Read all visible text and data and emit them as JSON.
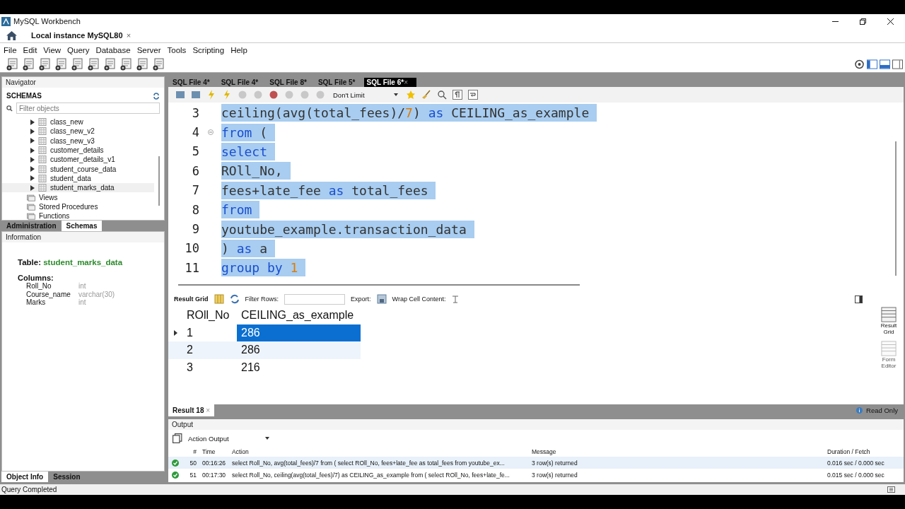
{
  "window": {
    "title": "MySQL Workbench"
  },
  "connection_tab": {
    "label": "Local instance MySQL80",
    "close": "×"
  },
  "menu": [
    "File",
    "Edit",
    "View",
    "Query",
    "Database",
    "Server",
    "Tools",
    "Scripting",
    "Help"
  ],
  "navigator": {
    "title": "Navigator",
    "schemas_label": "SCHEMAS",
    "filter_placeholder": "Filter objects",
    "tables": [
      {
        "name": "class_new",
        "selected": false
      },
      {
        "name": "class_new_v2",
        "selected": false
      },
      {
        "name": "class_new_v3",
        "selected": false
      },
      {
        "name": "customer_details",
        "selected": false
      },
      {
        "name": "customer_details_v1",
        "selected": false
      },
      {
        "name": "student_course_data",
        "selected": false
      },
      {
        "name": "student_data",
        "selected": false
      },
      {
        "name": "student_marks_data",
        "selected": true
      }
    ],
    "folders": [
      "Views",
      "Stored Procedures",
      "Functions"
    ]
  },
  "side_tabs": [
    {
      "label": "Administration",
      "selected": false
    },
    {
      "label": "Schemas",
      "selected": true
    }
  ],
  "information": {
    "title": "Information",
    "table_label": "Table:",
    "table_name": "student_marks_data",
    "columns_label": "Columns:",
    "columns": [
      {
        "name": "Roll_No",
        "type": "int"
      },
      {
        "name": "Course_name",
        "type": "varchar(30)"
      },
      {
        "name": "Marks",
        "type": "int"
      }
    ]
  },
  "bottom_tabs": [
    {
      "label": "Object Info",
      "selected": true
    },
    {
      "label": "Session",
      "selected": false
    }
  ],
  "editor_tabs": [
    {
      "label": "SQL File 4*",
      "selected": false
    },
    {
      "label": "SQL File 4*",
      "selected": false
    },
    {
      "label": "SQL File 8*",
      "selected": false
    },
    {
      "label": "SQL File 5*",
      "selected": false
    },
    {
      "label": "SQL File 6*",
      "selected": true
    }
  ],
  "editor_tab_close": "×",
  "limit": "Don't Limit",
  "code_lines": [
    {
      "number": "3",
      "selected": true,
      "fold": false,
      "tokens": [
        {
          "text": "ceiling(avg(total_fees)/",
          "kind": "plain"
        },
        {
          "text": "7",
          "kind": "number"
        },
        {
          "text": ") ",
          "kind": "plain"
        },
        {
          "text": "as",
          "kind": "keyword"
        },
        {
          "text": " CEILING_as_example",
          "kind": "plain"
        }
      ]
    },
    {
      "number": "4",
      "selected": true,
      "fold": true,
      "tokens": [
        {
          "text": "from",
          "kind": "keyword"
        },
        {
          "text": " (",
          "kind": "plain"
        }
      ]
    },
    {
      "number": "5",
      "selected": true,
      "fold": false,
      "tokens": [
        {
          "text": "select",
          "kind": "keyword"
        }
      ]
    },
    {
      "number": "6",
      "selected": true,
      "fold": false,
      "tokens": [
        {
          "text": "ROll_No,",
          "kind": "plain"
        }
      ]
    },
    {
      "number": "7",
      "selected": true,
      "fold": false,
      "tokens": [
        {
          "text": "fees+late_fee ",
          "kind": "plain"
        },
        {
          "text": "as",
          "kind": "keyword"
        },
        {
          "text": " total_fees",
          "kind": "plain"
        }
      ]
    },
    {
      "number": "8",
      "selected": true,
      "fold": false,
      "tokens": [
        {
          "text": "from",
          "kind": "keyword"
        }
      ]
    },
    {
      "number": "9",
      "selected": true,
      "fold": false,
      "tokens": [
        {
          "text": "youtube_example.transaction_data",
          "kind": "plain"
        }
      ]
    },
    {
      "number": "10",
      "selected": true,
      "fold": false,
      "tokens": [
        {
          "text": ") ",
          "kind": "plain"
        },
        {
          "text": "as",
          "kind": "keyword"
        },
        {
          "text": " a",
          "kind": "plain"
        }
      ]
    },
    {
      "number": "11",
      "selected": true,
      "fold": false,
      "tokens": [
        {
          "text": "group by",
          "kind": "keyword"
        },
        {
          "text": " 1",
          "kind": "number"
        }
      ]
    }
  ],
  "result_toolbar": {
    "grid_label": "Result Grid",
    "filter_label": "Filter Rows:",
    "export_label": "Export:",
    "wrap_label": "Wrap Cell Content:"
  },
  "result_grid": {
    "columns": [
      "ROll_No",
      "CEILING_as_example"
    ],
    "rows": [
      {
        "cells": [
          "1",
          "286"
        ],
        "selected": true
      },
      {
        "cells": [
          "2",
          "286"
        ],
        "selected": false
      },
      {
        "cells": [
          "3",
          "216"
        ],
        "selected": false
      }
    ]
  },
  "side_buttons": [
    {
      "label": "Result Grid",
      "selected": true
    },
    {
      "label": "Form Editor",
      "selected": false
    }
  ],
  "result_tab": {
    "label": "Result 18",
    "close": "×"
  },
  "read_only": "Read Only",
  "output": {
    "title": "Output",
    "mode": "Action Output",
    "columns": [
      "#",
      "Time",
      "Action",
      "Message",
      "Duration / Fetch"
    ],
    "rows": [
      {
        "number": "50",
        "time": "00:16:26",
        "action": "select Roll_No, avg(total_fees)/7 from ( select  ROll_No, fees+late_fee as total_fees  from  youtube_ex...",
        "message": "3 row(s) returned",
        "duration": "0.016 sec / 0.000 sec",
        "selected": true
      },
      {
        "number": "51",
        "time": "00:17:30",
        "action": "select Roll_No, ceiling(avg(total_fees)/7) as CEILING_as_example from ( select  ROll_No, fees+late_fe...",
        "message": "3 row(s) returned",
        "duration": "0.015 sec / 0.000 sec",
        "selected": false
      }
    ]
  },
  "status_bar": "Query Completed"
}
